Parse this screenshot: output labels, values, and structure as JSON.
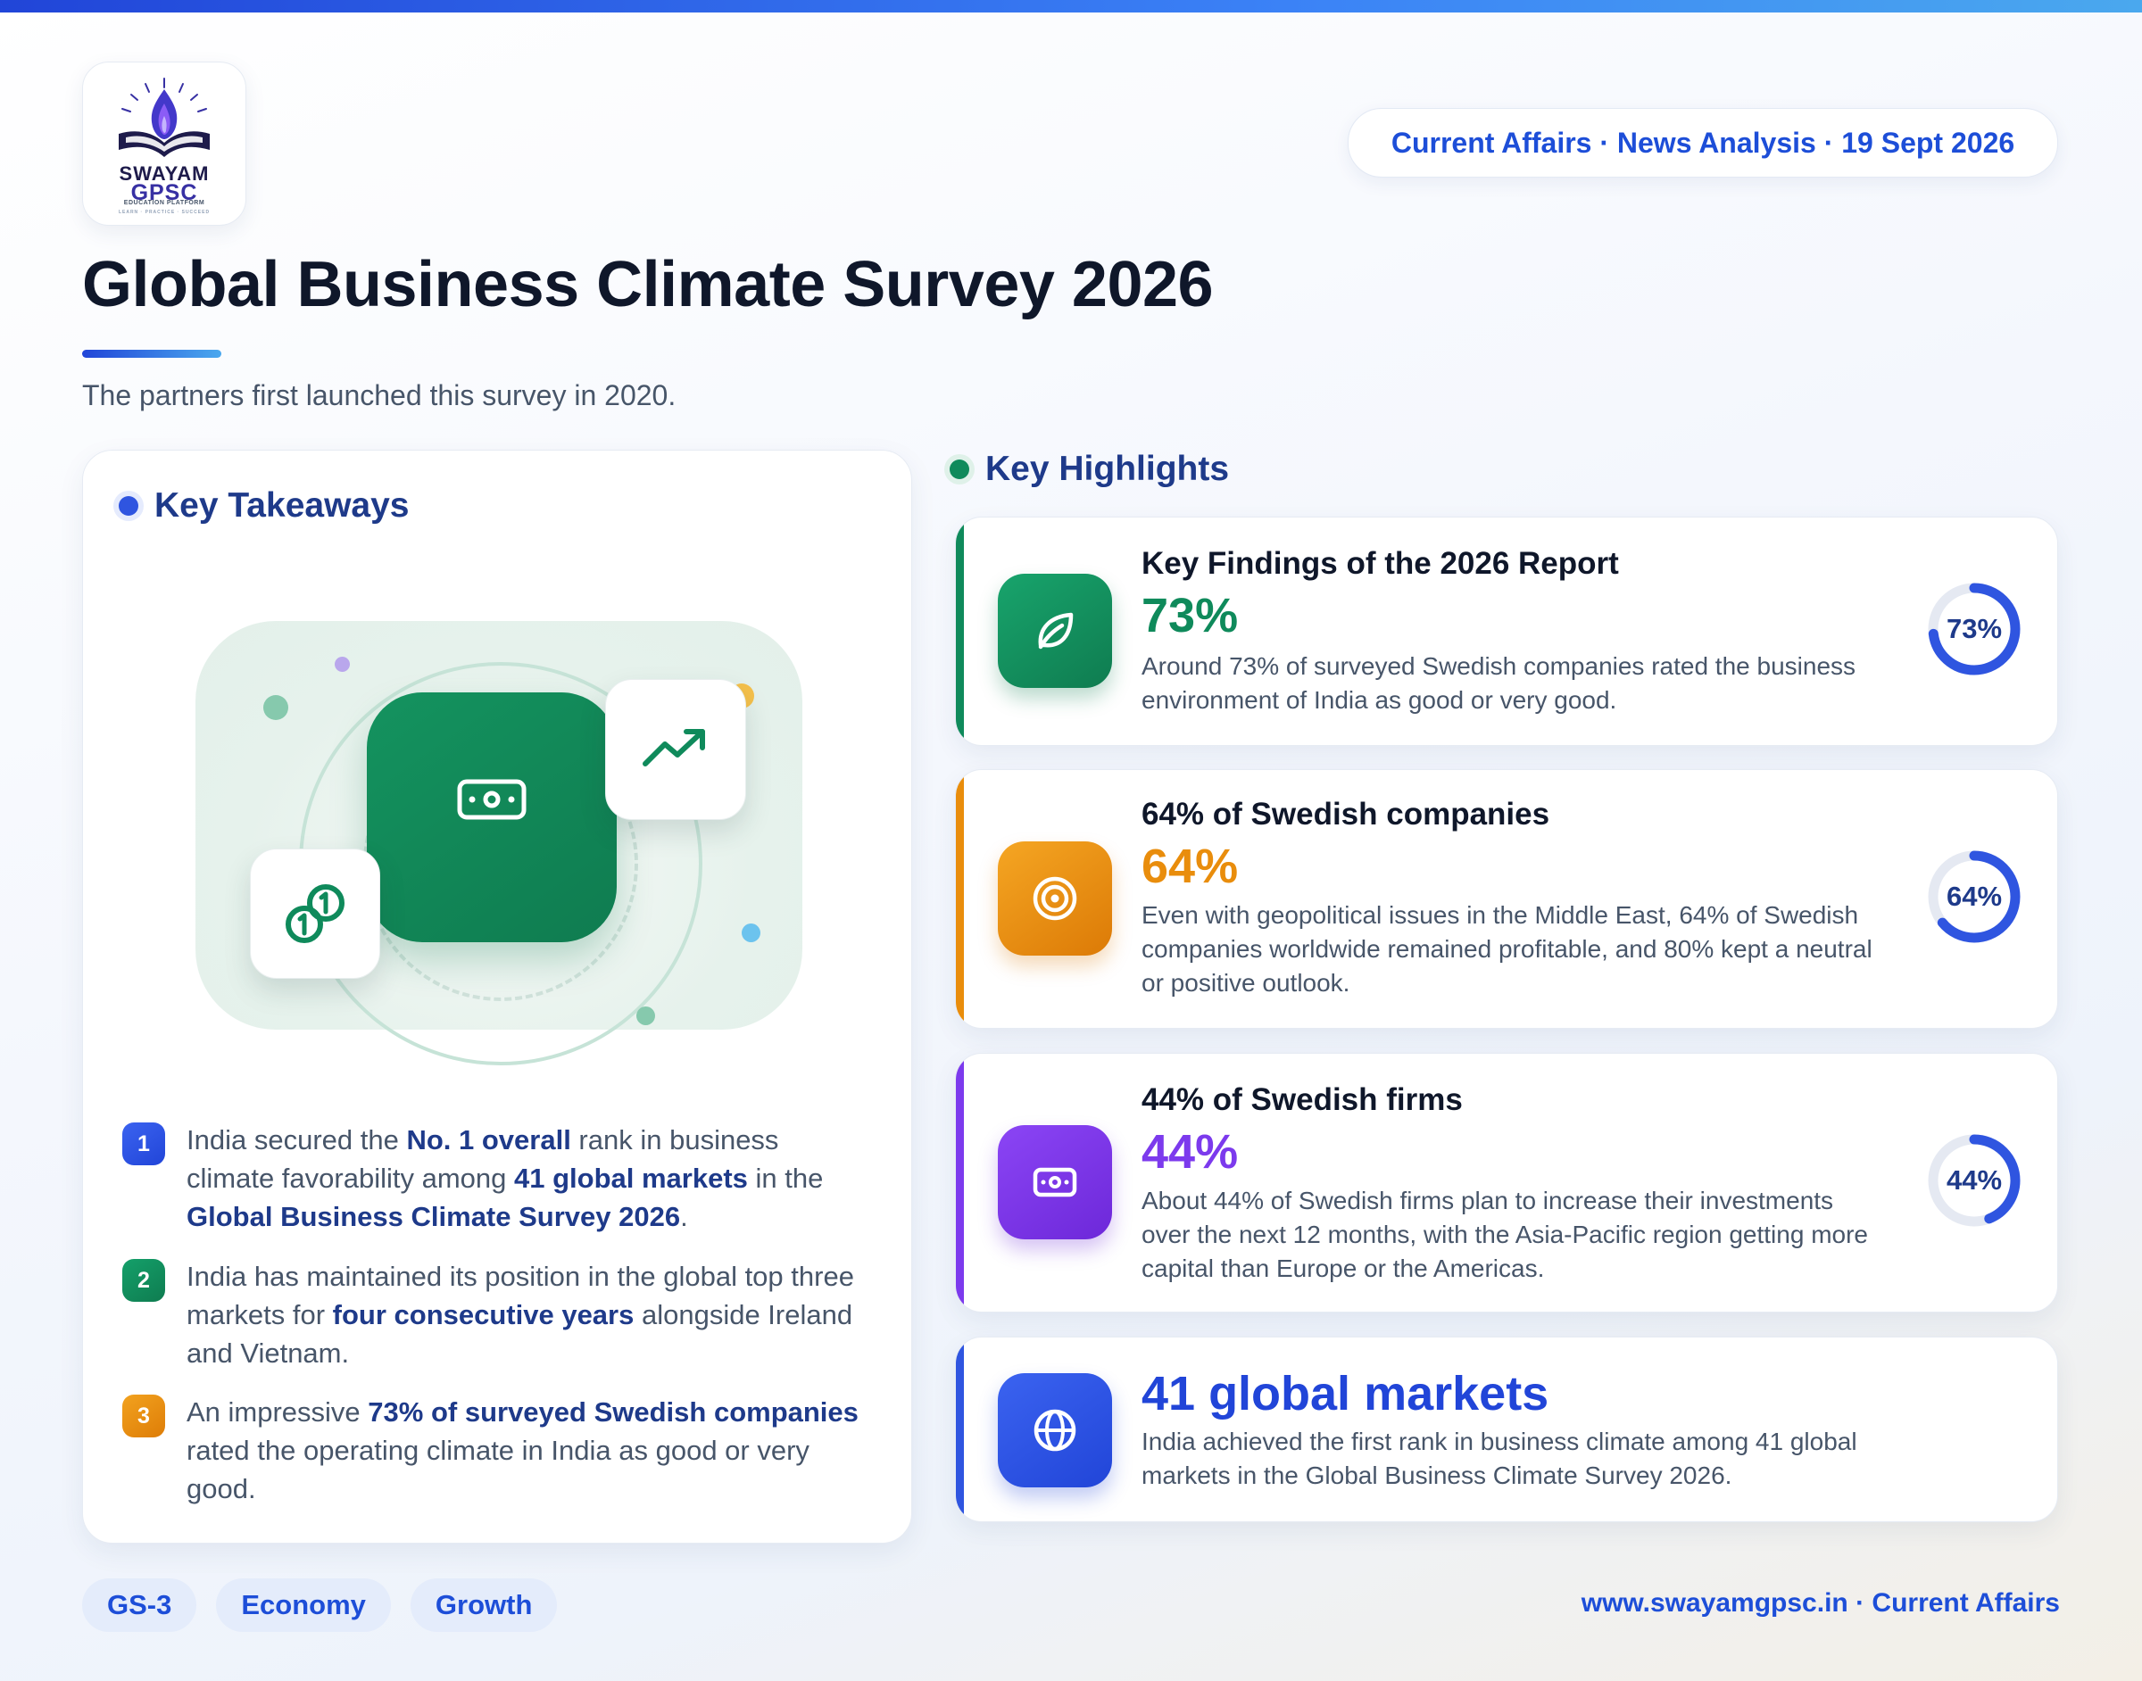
{
  "header": {
    "logo": {
      "line1": "SWAYAM",
      "line2": "GPSC",
      "line3": "EDUCATION PLATFORM",
      "line4": "LEARN · PRACTICE · SUCCEED"
    },
    "pill": "Current Affairs · News Analysis · 19 Sept 2026",
    "title": "Global Business Climate Survey 2026",
    "subtitle": "The partners first launched this survey in 2020."
  },
  "takeaways": {
    "heading": "Key Takeaways",
    "items": [
      {
        "num": "1",
        "parts": [
          "India secured the ",
          "No. 1 overall",
          " rank in business climate favorability among ",
          "41 global markets",
          " in the ",
          "Global Business Climate Survey 2026",
          "."
        ]
      },
      {
        "num": "2",
        "parts": [
          "India has maintained its position in the global top three markets for ",
          "four consecutive years",
          " alongside Ireland and Vietnam."
        ]
      },
      {
        "num": "3",
        "parts": [
          "An impressive ",
          "73% of surveyed Swedish companies",
          " rated the operating climate in India as good or very good."
        ]
      }
    ]
  },
  "highlights": {
    "heading": "Key Highlights",
    "cards": [
      {
        "icon": "leaf-icon",
        "title": "Key Findings of the 2026 Report",
        "value": "73%",
        "percent": 73,
        "desc": "Around 73% of surveyed Swedish companies rated the business environment of India as good or very good.",
        "color": "#0f8a5b"
      },
      {
        "icon": "target-icon",
        "title": "64% of Swedish companies",
        "value": "64%",
        "percent": 64,
        "desc": "Even with geopolitical issues in the Middle East, 64% of Swedish companies worldwide remained profitable, and 80% kept a neutral or positive outlook.",
        "color": "#e98d0c"
      },
      {
        "icon": "banknote-icon",
        "title": "44% of Swedish firms",
        "value": "44%",
        "percent": 44,
        "desc": "About 44% of Swedish firms plan to increase their investments over the next 12 months, with the Asia-Pacific region getting more capital than Europe or the Americas.",
        "color": "#7c3aed"
      },
      {
        "icon": "globe-icon",
        "value": "41 global markets",
        "desc": "India achieved the first rank in business climate among 41 global markets in the Global Business Climate Survey 2026.",
        "color": "#2145d8"
      }
    ],
    "donut_color": "#2f55e0"
  },
  "footer": {
    "tags": [
      "GS-3",
      "Economy",
      "Growth"
    ],
    "site": "www.swayamgpsc.in · Current Affairs"
  }
}
